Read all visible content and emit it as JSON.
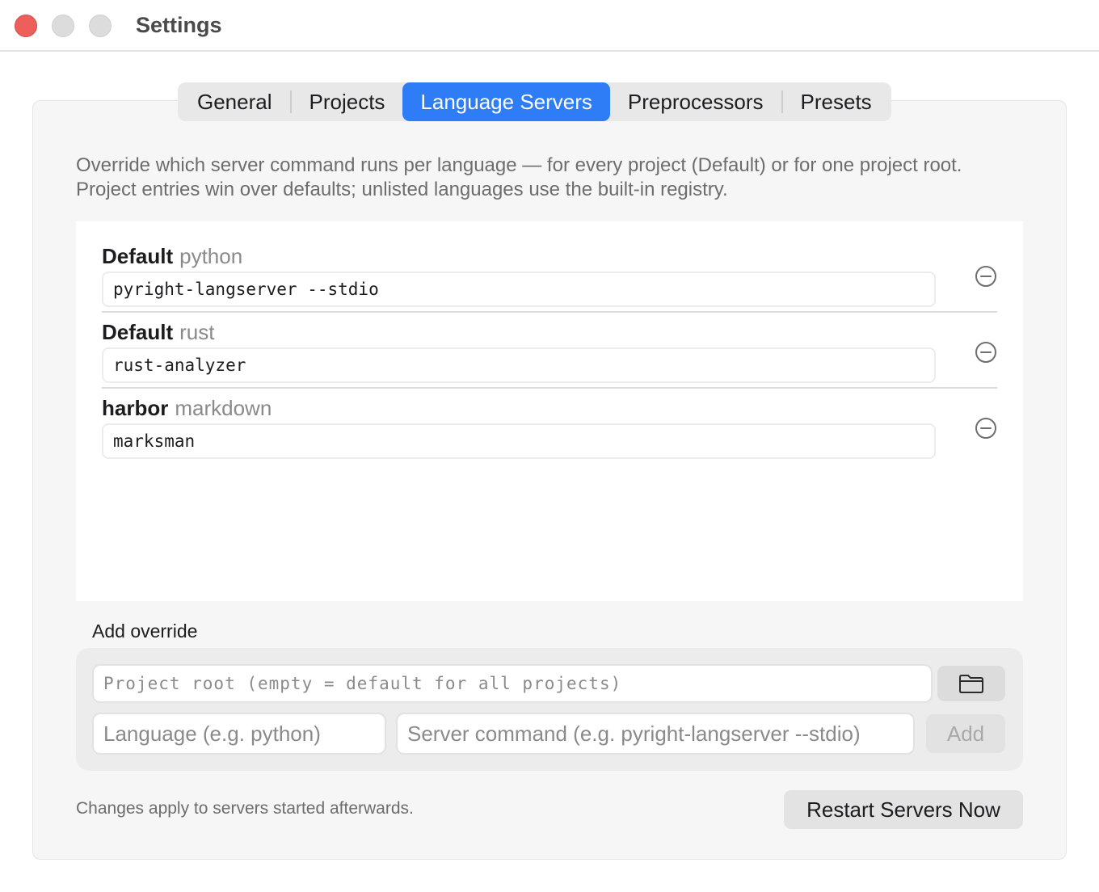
{
  "window": {
    "title": "Settings"
  },
  "tabs": [
    {
      "label": "General"
    },
    {
      "label": "Projects"
    },
    {
      "label": "Language Servers",
      "active": true
    },
    {
      "label": "Preprocessors"
    },
    {
      "label": "Presets"
    }
  ],
  "description": {
    "line1": "Override which server command runs per language — for every project (Default) or for one project root.",
    "line2": "Project entries win over defaults; unlisted languages use the built-in registry."
  },
  "overrides": [
    {
      "scope": "Default",
      "language": "python",
      "command": "pyright-langserver --stdio"
    },
    {
      "scope": "Default",
      "language": "rust",
      "command": "rust-analyzer"
    },
    {
      "scope": "harbor",
      "language": "markdown",
      "command": "marksman"
    }
  ],
  "add_override": {
    "title": "Add override",
    "root_placeholder": "Project root (empty = default for all projects)",
    "language_placeholder": "Language (e.g. python)",
    "command_placeholder": "Server command (e.g. pyright-langserver --stdio)",
    "add_label": "Add"
  },
  "footer": {
    "note": "Changes apply to servers started afterwards.",
    "restart_label": "Restart Servers Now"
  },
  "icons": {
    "remove": "minus-circle-icon",
    "folder": "folder-icon"
  },
  "colors": {
    "accent": "#2f7df6",
    "close": "#ec5f5a"
  }
}
